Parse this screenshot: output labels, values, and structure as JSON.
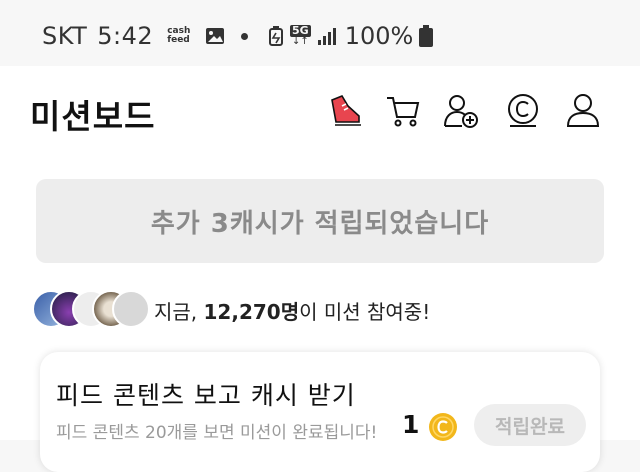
{
  "status_bar": {
    "carrier": "SKT",
    "time": "5:42",
    "cashfeed_icon_text": "cash feed",
    "network": "5G",
    "battery_percent": "100%"
  },
  "header": {
    "title": "미션보드",
    "icons": [
      "shoe-icon",
      "cart-icon",
      "add-friend-icon",
      "coin-history-icon",
      "profile-icon"
    ]
  },
  "notice": {
    "text": "추가 3캐시가 적립되었습니다"
  },
  "participants": {
    "prefix": "지금, ",
    "count": "12,270명",
    "suffix": "이 미션 참여중!"
  },
  "mission_card": {
    "title": "피드 콘텐츠 보고 캐시 받기",
    "description": "피드 콘텐츠 20개를 보면 미션이 완료됩니다!",
    "reward": "1",
    "button_label": "적립완료"
  },
  "colors": {
    "accent_red": "#e8454f",
    "coin_gold": "#f2b71b",
    "muted_text": "#8a8a8a"
  }
}
